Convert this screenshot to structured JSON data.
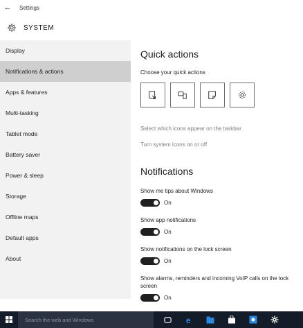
{
  "window": {
    "title": "Settings",
    "back_icon": "back-arrow-icon"
  },
  "header": {
    "icon": "gear-icon",
    "title": "SYSTEM"
  },
  "sidebar": {
    "items": [
      {
        "label": "Display",
        "active": false
      },
      {
        "label": "Notifications & actions",
        "active": true
      },
      {
        "label": "Apps & features",
        "active": false
      },
      {
        "label": "Multi-tasking",
        "active": false
      },
      {
        "label": "Tablet mode",
        "active": false
      },
      {
        "label": "Battery saver",
        "active": false
      },
      {
        "label": "Power & sleep",
        "active": false
      },
      {
        "label": "Storage",
        "active": false
      },
      {
        "label": "Offline maps",
        "active": false
      },
      {
        "label": "Default apps",
        "active": false
      },
      {
        "label": "About",
        "active": false
      }
    ]
  },
  "quick_actions": {
    "title": "Quick actions",
    "subtitle": "Choose your quick actions",
    "tiles": [
      {
        "icon": "tablet-mode-icon"
      },
      {
        "icon": "connect-icon"
      },
      {
        "icon": "note-icon"
      },
      {
        "icon": "settings-icon"
      }
    ],
    "link_taskbar_icons": "Select which icons appear on the taskbar",
    "link_system_icons": "Turn system icons on or off"
  },
  "notifications": {
    "title": "Notifications",
    "settings": [
      {
        "label": "Show me tips about Windows",
        "state": "On"
      },
      {
        "label": "Show app notifications",
        "state": "On"
      },
      {
        "label": "Show notifications on the lock screen",
        "state": "On"
      },
      {
        "label": "Show alarms, reminders and incoming VoIP calls on the lock screen",
        "state": "On"
      }
    ]
  },
  "taskbar": {
    "search_placeholder": "Search the web and Windows",
    "icons": [
      "task-view-icon",
      "edge-icon",
      "file-explorer-icon",
      "store-icon",
      "app-icon",
      "settings-icon"
    ],
    "accent": "#2b86e0"
  }
}
